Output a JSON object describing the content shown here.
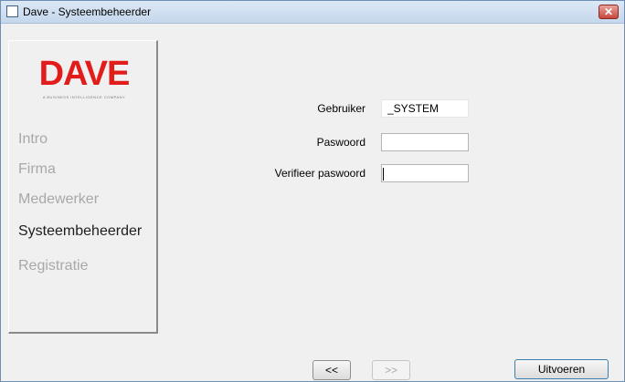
{
  "window": {
    "title": "Dave - Systeembeheerder",
    "close_symbol": "✕"
  },
  "logo": {
    "text": "DAVE",
    "subtitle": "A BUSINESS INTELLIGENCE COMPANY"
  },
  "sidebar": {
    "items": [
      {
        "label": "Intro",
        "state": "inactive"
      },
      {
        "label": "Firma",
        "state": "inactive"
      },
      {
        "label": "Medewerker",
        "state": "inactive"
      },
      {
        "label": "Systeembeheerder",
        "state": "active"
      },
      {
        "label": "Registratie",
        "state": "inactive"
      }
    ]
  },
  "form": {
    "user_label": "Gebruiker",
    "user_value": "_SYSTEM",
    "password_label": "Paswoord",
    "password_value": "",
    "verify_label": "Verifieer paswoord",
    "verify_value": ""
  },
  "buttons": {
    "back_label": "<<",
    "next_label": ">>",
    "execute_label": "Uitvoeren"
  },
  "colors": {
    "logo_red": "#e21b1b",
    "inactive_nav": "#a8a8a8",
    "active_nav": "#202020"
  }
}
